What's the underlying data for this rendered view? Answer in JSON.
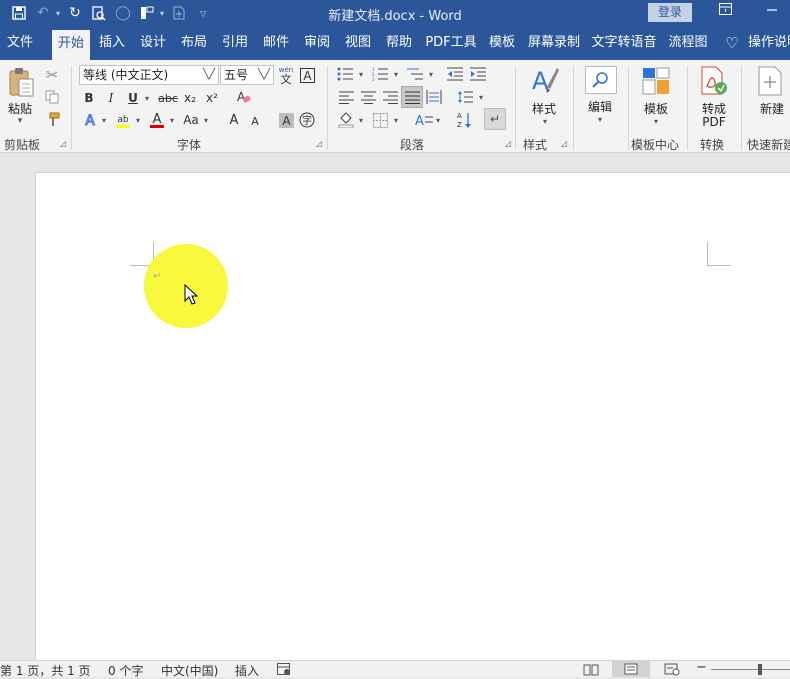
{
  "app": {
    "title": "新建文档.docx  -  Word",
    "login": "登录"
  },
  "tabs": [
    "文件",
    "开始",
    "插入",
    "设计",
    "布局",
    "引用",
    "邮件",
    "审阅",
    "视图",
    "帮助",
    "PDF工具",
    "模板",
    "屏幕录制",
    "文字转语音",
    "流程图",
    "操作说明"
  ],
  "active_tab": "开始",
  "ribbon": {
    "clipboard": {
      "paste": "粘贴",
      "label": "剪贴板"
    },
    "font": {
      "name": "等线 (中文正文)",
      "size": "五号",
      "label": "字体",
      "bold": "B",
      "italic": "I",
      "underline": "U",
      "strike": "abc",
      "subscript": "x₂",
      "superscript": "x²",
      "grow": "A",
      "shrink": "A",
      "case": "Aa"
    },
    "paragraph": {
      "label": "段落"
    },
    "styles": {
      "button": "样式",
      "label": "样式"
    },
    "editing": {
      "button": "编辑"
    },
    "template": {
      "button": "模板",
      "label": "模板中心"
    },
    "convert": {
      "button_line1": "转成",
      "button_line2": "PDF",
      "label": "转换"
    },
    "new": {
      "button": "新建",
      "label": "快速新建"
    }
  },
  "document": {
    "paragraph_mark": "↵"
  },
  "status": {
    "page": "第 1 页，共 1 页",
    "words": "0 个字",
    "language": "中文(中国)",
    "mode": "插入"
  },
  "colors": {
    "brand": "#2b579a",
    "highlight_pen": "#f7f72c",
    "font_color": "#e00000",
    "text_highlight": "#ffff00"
  }
}
